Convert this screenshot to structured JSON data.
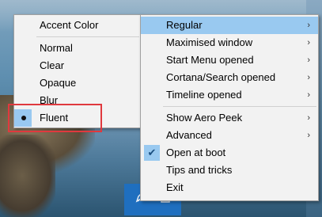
{
  "submenu": {
    "items": [
      {
        "label": "Accent Color"
      },
      {
        "label": "Normal"
      },
      {
        "label": "Clear"
      },
      {
        "label": "Opaque"
      },
      {
        "label": "Blur"
      },
      {
        "label": "Fluent"
      }
    ],
    "selected": "Fluent"
  },
  "main_menu": {
    "items": [
      {
        "label": "Regular",
        "arrow": "›"
      },
      {
        "label": "Maximised window",
        "arrow": "›"
      },
      {
        "label": "Start Menu opened",
        "arrow": "›"
      },
      {
        "label": "Cortana/Search opened",
        "arrow": "›"
      },
      {
        "label": "Timeline opened",
        "arrow": "›"
      },
      {
        "label": "Show Aero Peek",
        "arrow": "›"
      },
      {
        "label": "Advanced",
        "arrow": "›"
      },
      {
        "label": "Open at boot",
        "check": "✔"
      },
      {
        "label": "Tips and tricks"
      },
      {
        "label": "Exit"
      }
    ],
    "highlighted": "Regular",
    "checked": "Open at boot"
  },
  "tray": {
    "icons": [
      "pen-icon",
      "translucent-tb-icon"
    ]
  },
  "colors": {
    "highlight": "#99c9f0",
    "menu_bg": "#f2f2f2",
    "annotation_frame": "#e0393e",
    "taskbar": "#1f6fbf"
  }
}
